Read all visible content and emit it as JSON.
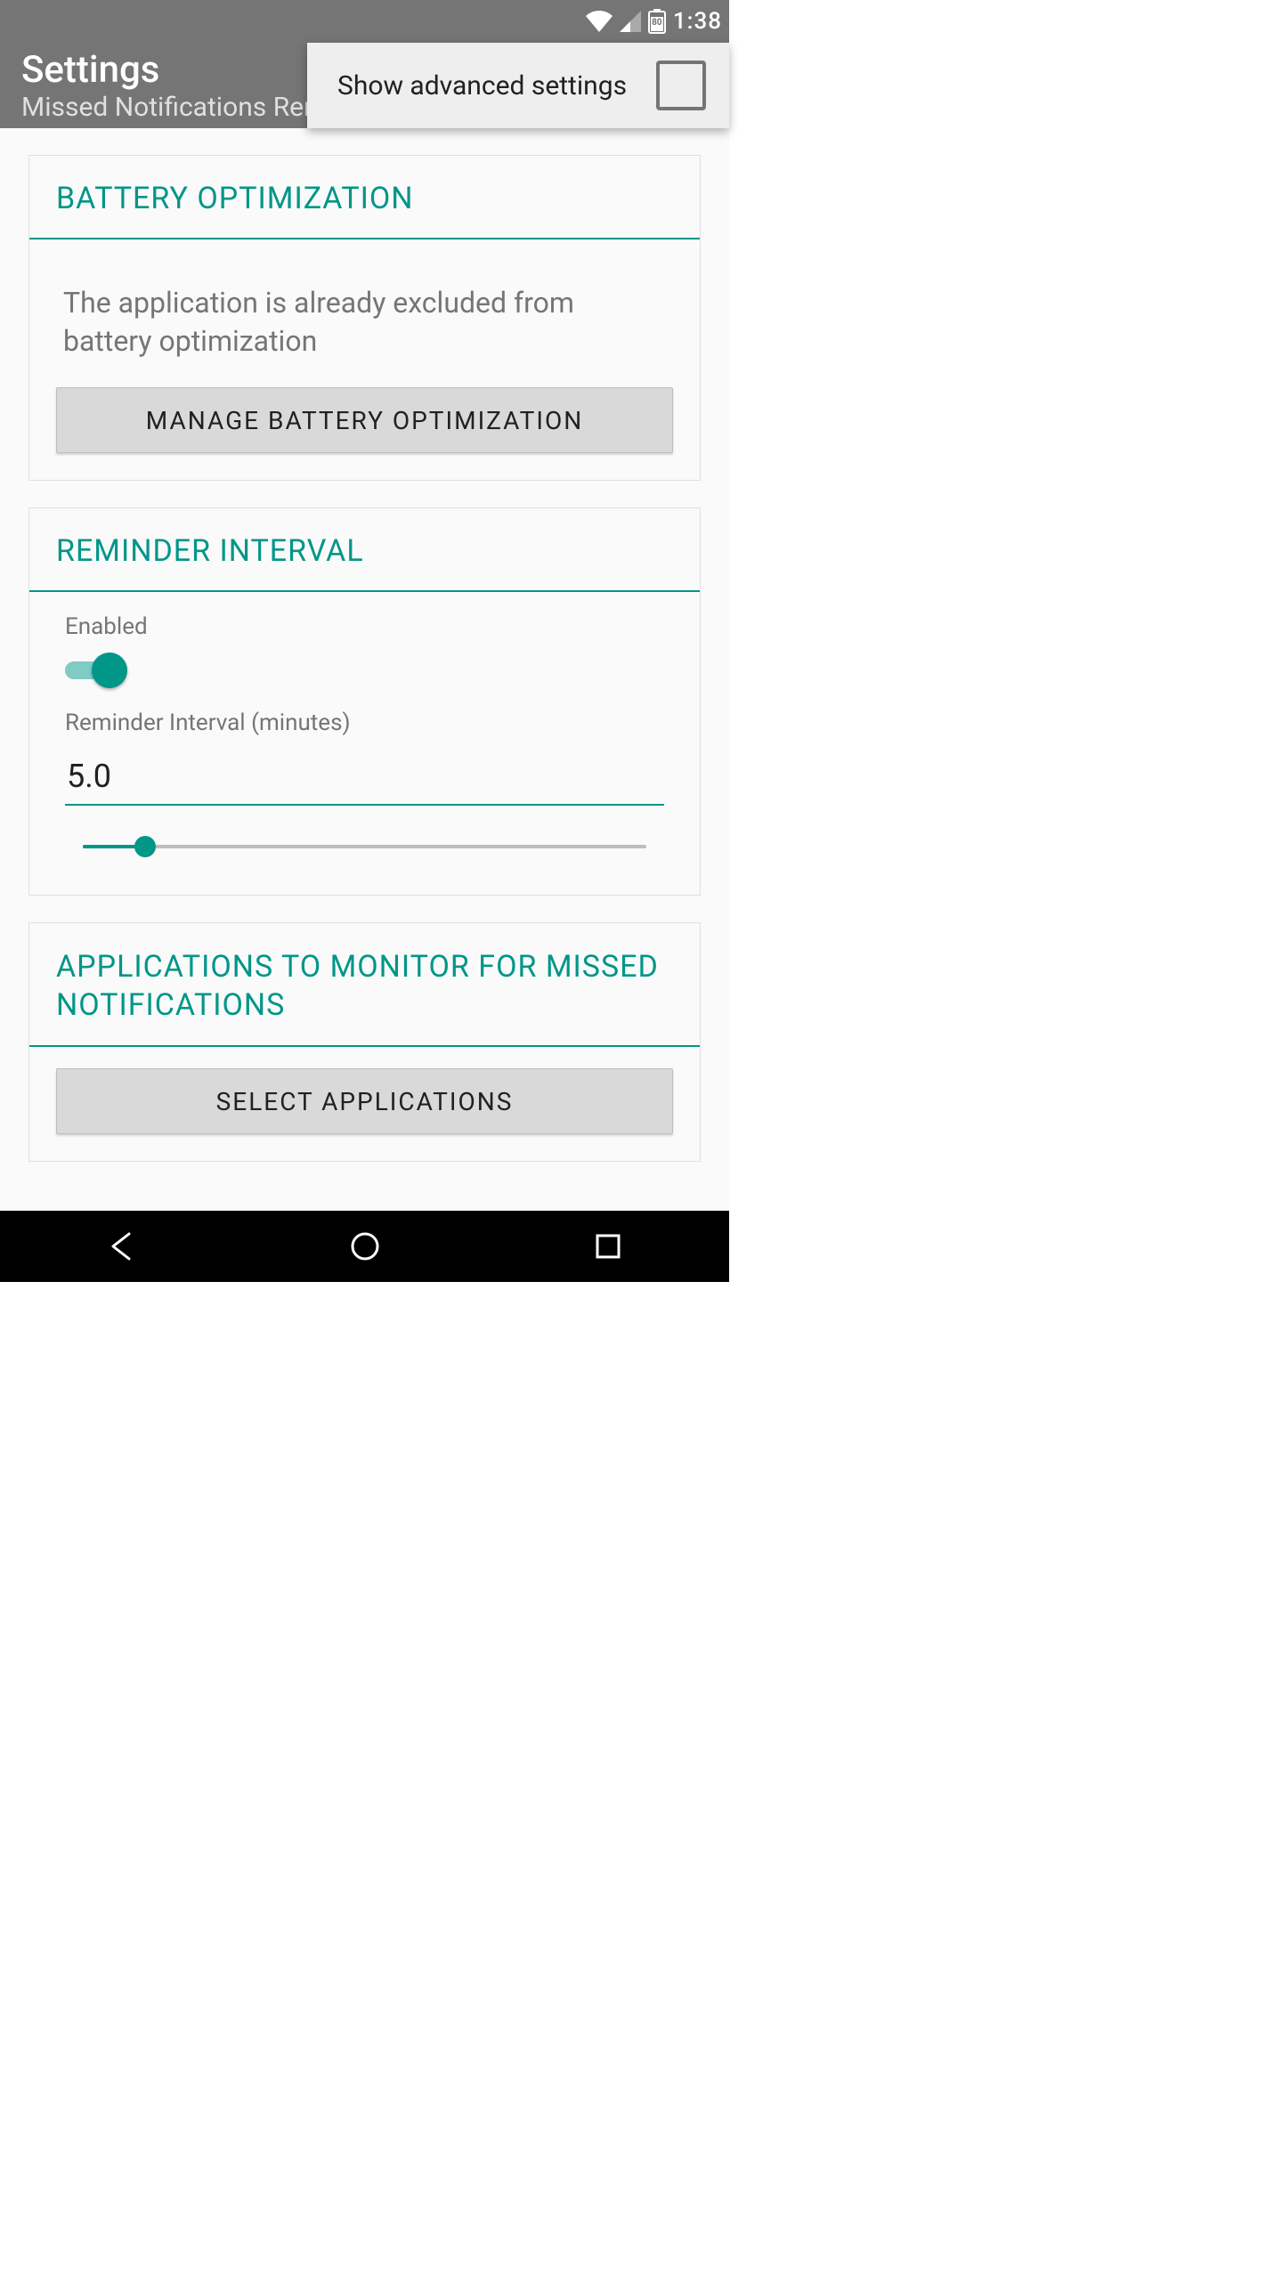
{
  "status": {
    "time": "1:38",
    "battery_level": "80"
  },
  "app_bar": {
    "title": "Settings",
    "subtitle": "Missed Notifications Reminder"
  },
  "popup": {
    "label": "Show advanced settings",
    "checked": false
  },
  "sections": {
    "battery": {
      "title": "BATTERY OPTIMIZATION",
      "description": "The application is already excluded from battery optimization",
      "button": "MANAGE BATTERY OPTIMIZATION"
    },
    "reminder": {
      "title": "REMINDER INTERVAL",
      "enabled_label": "Enabled",
      "enabled_value": true,
      "interval_label": "Reminder Interval (minutes)",
      "interval_value": "5.0",
      "slider_percent": 11
    },
    "apps": {
      "title": "APPLICATIONS TO MONITOR FOR MISSED NOTIFICATIONS",
      "button": "SELECT APPLICATIONS"
    }
  }
}
